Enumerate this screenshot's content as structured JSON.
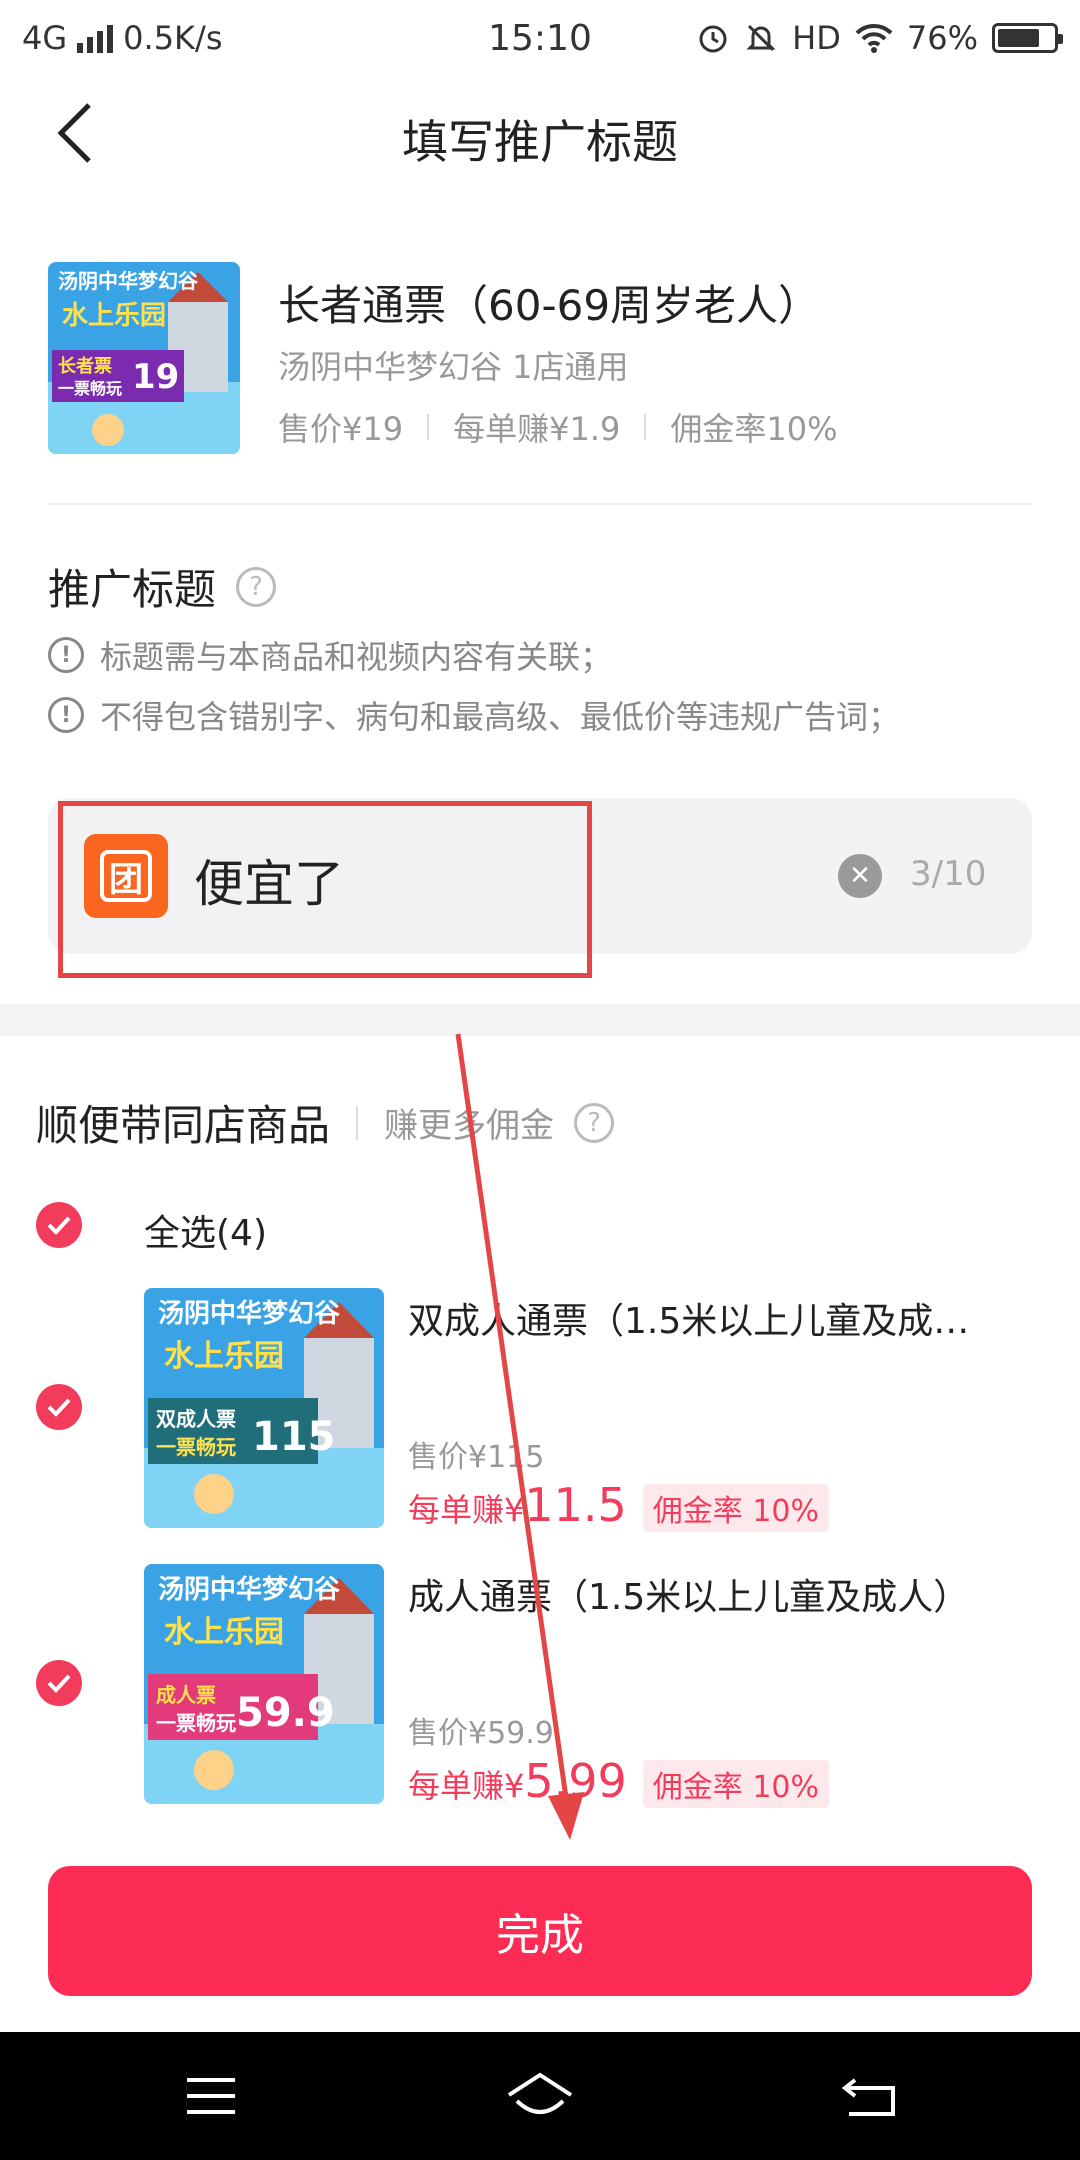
{
  "status_bar": {
    "network": "4G",
    "speed": "0.5K/s",
    "time": "15:10",
    "hd": "HD",
    "battery": "76%",
    "battery_level": 0.76
  },
  "header": {
    "title": "填写推广标题"
  },
  "product": {
    "thumb_title": "汤阴中华梦幻谷",
    "thumb_sub": "水上乐园",
    "thumb_badge": "长者票",
    "thumb_badge_sub": "一票畅玩",
    "thumb_price": "19",
    "name": "长者通票（60-69周岁老人）",
    "shop": "汤阴中华梦幻谷 1店通用",
    "price": "售价¥19",
    "earn": "每单赚¥1.9",
    "rate": "佣金率10%"
  },
  "promo_title": {
    "heading": "推广标题",
    "rules": [
      "标题需与本商品和视频内容有关联；",
      "不得包含错别字、病句和最高级、最低价等违规广告词；"
    ],
    "tuan_icon": "团",
    "value": "便宜了",
    "counter": "3/10"
  },
  "bundle": {
    "title": "顺便带同店商品",
    "subtitle": "赚更多佣金",
    "select_all": "全选(4)",
    "items": [
      {
        "thumb_badge": "双成人票",
        "thumb_badge_sub": "一票畅玩",
        "thumb_price": "115",
        "name": "双成人通票（1.5米以上儿童及成…",
        "price": "售价¥115",
        "earn_prefix": "每单赚¥",
        "earn_value": "11.5",
        "rate": "佣金率 10%"
      },
      {
        "thumb_badge": "成人票",
        "thumb_badge_sub": "一票畅玩",
        "thumb_price": "59.9",
        "name": "成人通票（1.5米以上儿童及成人）",
        "price": "售价¥59.9",
        "earn_prefix": "每单赚¥",
        "earn_value": "5.99",
        "rate": "佣金率 10%"
      }
    ]
  },
  "done_button": "完成",
  "colors": {
    "accent": "#fd2c55",
    "check": "#f23c5c",
    "tuan": "#fa6520",
    "annotation": "#e44646"
  }
}
